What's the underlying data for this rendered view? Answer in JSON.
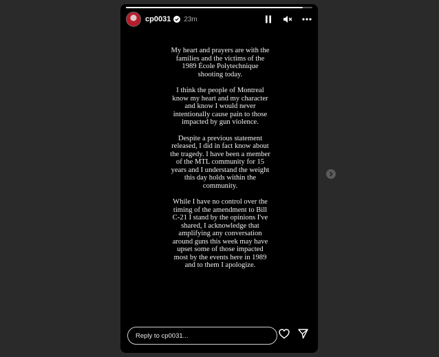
{
  "story": {
    "username": "cp0031",
    "time": "23m",
    "progress": 0.95,
    "message": [
      "My heart and prayers are with the families and the victims of the 1989 École Polytechnique shooting today.",
      "I think the people of Montreal know my heart and my character and know I would never intentionally cause pain to those impacted by gun violence.",
      "Despite a previous statement released, I did in fact know about the tragedy. I  have been a member of the MTL community for 15 years and I understand the weight this day holds within the community.",
      "While I have no control over the timing of the amendment to Bill C-21 I stand by the opinions I've shared, I acknowledge that amplifying any conversation around guns this week may have upset some of those impacted most by the events here in 1989 and to them I apologize."
    ]
  },
  "reply": {
    "placeholder": "Reply to cp0031..."
  },
  "icons": {
    "verified": "verified-badge-icon",
    "pause": "pause-icon",
    "mute": "mute-icon",
    "more": "more-icon",
    "like": "heart-icon",
    "share": "send-icon",
    "next": "chevron-right-icon"
  }
}
